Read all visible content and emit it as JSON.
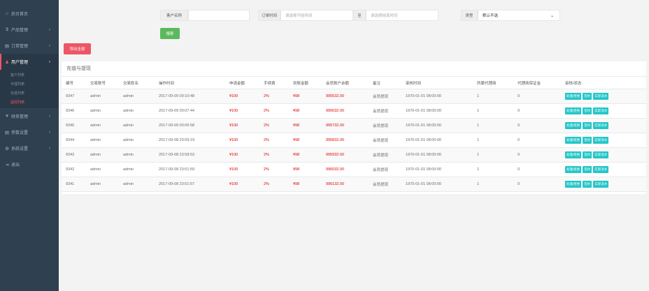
{
  "sidebar": {
    "items": [
      {
        "icon": "home-icon",
        "glyph": "⌂",
        "label": "后台首页"
      },
      {
        "icon": "product-icon",
        "glyph": "$",
        "label": "产品管理"
      },
      {
        "icon": "order-icon",
        "glyph": "▤",
        "label": "订单管理"
      },
      {
        "icon": "user-icon",
        "glyph": "♟",
        "label": "用户管理"
      },
      {
        "icon": "finance-icon",
        "glyph": "¥",
        "label": "财务管理"
      },
      {
        "icon": "params-icon",
        "glyph": "▤",
        "label": "参数设置"
      },
      {
        "icon": "settings-icon",
        "glyph": "⚙",
        "label": "系统设置"
      },
      {
        "icon": "logout-icon",
        "glyph": "⇥",
        "label": "退出"
      }
    ],
    "user_sub": [
      "客户列表",
      "代理列表",
      "充值列表",
      "提现列表"
    ]
  },
  "filters": {
    "customer_label": "客户名称",
    "customer_value": "",
    "order_time_label": "订单时间",
    "start_placeholder": "请选择开始时间",
    "to_label": "至",
    "end_placeholder": "请选择结束时间",
    "type_label": "类型",
    "type_value": "默认不选"
  },
  "buttons": {
    "search": "搜索",
    "export": "导出全部"
  },
  "panel_title": "充值与提现",
  "columns": [
    "编号",
    "交易账号",
    "交易姓名",
    "操作时间",
    "申请金额",
    "手续费",
    "到账金额",
    "会员账户余额",
    "备注",
    "审核时间",
    "所属代理商",
    "代理商保证金",
    "审核/状态"
  ],
  "rows": [
    {
      "id": "9347",
      "account": "admin",
      "name": "admin",
      "time": "2017-09-09 00:10:48",
      "apply": "¥100",
      "fee": "2%",
      "arrive": "¥98",
      "balance": "995532.00",
      "remark": "会员提现",
      "audit_time": "1970-01-01 08:00:00",
      "agent": "1",
      "deposit": "0"
    },
    {
      "id": "9346",
      "account": "admin",
      "name": "admin",
      "time": "2017-09-09 00:07:44",
      "apply": "¥100",
      "fee": "2%",
      "arrive": "¥98",
      "balance": "995632.00",
      "remark": "会员提现",
      "audit_time": "1970-01-01 08:00:00",
      "agent": "1",
      "deposit": "0"
    },
    {
      "id": "9345",
      "account": "admin",
      "name": "admin",
      "time": "2017-09-09 00:06:58",
      "apply": "¥100",
      "fee": "2%",
      "arrive": "¥98",
      "balance": "995732.00",
      "remark": "会员提现",
      "audit_time": "1970-01-01 08:00:00",
      "agent": "1",
      "deposit": "0"
    },
    {
      "id": "9344",
      "account": "admin",
      "name": "admin",
      "time": "2017-09-08 23:59:19",
      "apply": "¥100",
      "fee": "2%",
      "arrive": "¥98",
      "balance": "995832.00",
      "remark": "会员提现",
      "audit_time": "1970-01-01 08:00:00",
      "agent": "1",
      "deposit": "0"
    },
    {
      "id": "9343",
      "account": "admin",
      "name": "admin",
      "time": "2017-09-08 23:58:53",
      "apply": "¥100",
      "fee": "2%",
      "arrive": "¥98",
      "balance": "995932.00",
      "remark": "会员提现",
      "audit_time": "1970-01-01 08:00:00",
      "agent": "1",
      "deposit": "0"
    },
    {
      "id": "9342",
      "account": "admin",
      "name": "admin",
      "time": "2017-09-08 23:51:59",
      "apply": "¥100",
      "fee": "2%",
      "arrive": "¥98",
      "balance": "996032.00",
      "remark": "会员提现",
      "audit_time": "1970-01-01 08:00:00",
      "agent": "1",
      "deposit": "0"
    },
    {
      "id": "9341",
      "account": "admin",
      "name": "admin",
      "time": "2017-09-08 23:51:57",
      "apply": "¥100",
      "fee": "2%",
      "arrive": "¥98",
      "balance": "996132.00",
      "remark": "会员提现",
      "audit_time": "1970-01-01 08:00:00",
      "agent": "1",
      "deposit": "0"
    }
  ],
  "row_actions": [
    "处理/拒绝",
    "签约",
    "实际流水"
  ],
  "colors": {
    "sidebar": "#2f4050",
    "search_btn": "#5cb85c",
    "export_btn": "#ed5565",
    "action_btn": "#23c6c8",
    "money_red": "#e30000"
  }
}
